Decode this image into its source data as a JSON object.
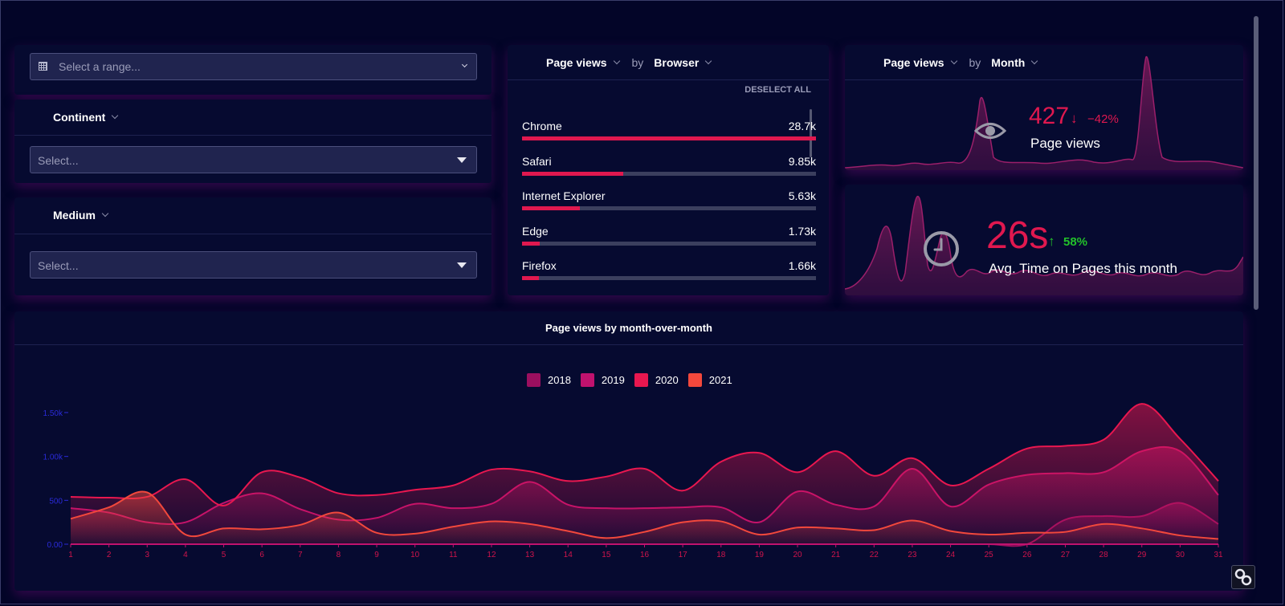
{
  "filters": {
    "range_placeholder": "Select a range...",
    "continent_label": "Continent",
    "continent_placeholder": "Select...",
    "medium_label": "Medium",
    "medium_placeholder": "Select..."
  },
  "browser_card": {
    "metric": "Page views",
    "by": "by",
    "dimension": "Browser",
    "deselect_all": "DESELECT ALL",
    "items": [
      {
        "label": "Chrome",
        "value": "28.7k",
        "fraction": 1.0
      },
      {
        "label": "Safari",
        "value": "9.85k",
        "fraction": 0.343
      },
      {
        "label": "Internet Explorer",
        "value": "5.63k",
        "fraction": 0.196
      },
      {
        "label": "Edge",
        "value": "1.73k",
        "fraction": 0.06
      },
      {
        "label": "Firefox",
        "value": "1.66k",
        "fraction": 0.058
      }
    ]
  },
  "month_card": {
    "metric": "Page views",
    "by": "by",
    "dimension": "Month",
    "kpi_value": "427",
    "kpi_change": "−42%",
    "kpi_label": "Page views"
  },
  "time_card": {
    "kpi_value": "26s",
    "kpi_change": "58%",
    "kpi_label": "Avg. Time on Pages this month"
  },
  "colors": {
    "accent": "#e0184f",
    "down": "#e0184f",
    "up": "#22c12a",
    "s2018": "#9b0f5f",
    "s2019": "#c0126e",
    "s2020": "#e8174f",
    "s2021": "#f2483c"
  },
  "chart_data": {
    "type": "area",
    "title": "Page views by month-over-month",
    "x": [
      1,
      2,
      3,
      4,
      5,
      6,
      7,
      8,
      9,
      10,
      11,
      12,
      13,
      14,
      15,
      16,
      17,
      18,
      19,
      20,
      21,
      22,
      23,
      24,
      25,
      26,
      27,
      28,
      29,
      30,
      31
    ],
    "ylim": [
      0,
      1500
    ],
    "yticks": [
      "0.00",
      "500",
      "1.00k",
      "1.50k"
    ],
    "legend_position": "top-center",
    "series": [
      {
        "name": "2018",
        "color": "#9b0f5f",
        "values": [
          0,
          0,
          0,
          0,
          0,
          0,
          0,
          0,
          0,
          0,
          0,
          0,
          0,
          0,
          0,
          0,
          0,
          0,
          0,
          0,
          0,
          0,
          0,
          0,
          0,
          0,
          280,
          320,
          320,
          470,
          230
        ]
      },
      {
        "name": "2019",
        "color": "#c0126e",
        "values": [
          410,
          360,
          250,
          250,
          470,
          580,
          400,
          280,
          300,
          460,
          410,
          460,
          710,
          450,
          410,
          410,
          420,
          420,
          250,
          600,
          450,
          430,
          860,
          430,
          680,
          790,
          810,
          820,
          1060,
          1060,
          560
        ]
      },
      {
        "name": "2020",
        "color": "#e8174f",
        "values": [
          540,
          530,
          540,
          740,
          440,
          820,
          760,
          580,
          560,
          620,
          670,
          850,
          830,
          720,
          770,
          860,
          610,
          940,
          1040,
          820,
          1060,
          780,
          980,
          670,
          860,
          1090,
          1120,
          1190,
          1600,
          1200,
          720
        ]
      },
      {
        "name": "2021",
        "color": "#f2483c",
        "values": [
          290,
          420,
          590,
          110,
          180,
          170,
          220,
          360,
          130,
          120,
          200,
          260,
          230,
          150,
          70,
          140,
          250,
          260,
          110,
          190,
          180,
          160,
          270,
          150,
          110,
          130,
          140,
          230,
          180,
          100,
          60
        ]
      }
    ]
  }
}
